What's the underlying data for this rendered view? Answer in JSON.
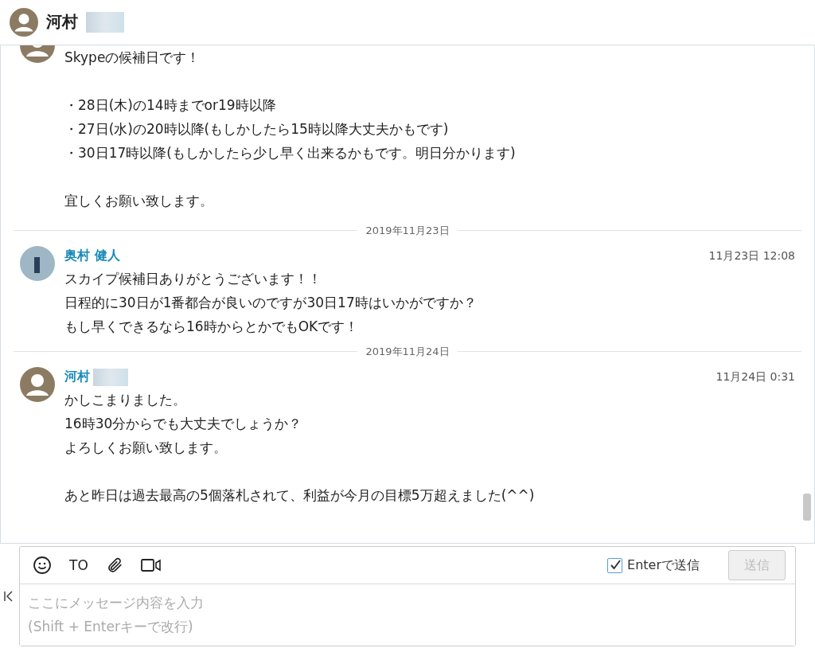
{
  "header": {
    "name": "河村"
  },
  "messages": [
    {
      "kind": "clipped",
      "paragraphs": [
        [
          "Skypeの候補日です！"
        ],
        [
          "・28日(木)の14時までor19時以降",
          "・27日(水)の20時以降(もしかしたら15時以降大丈夫かもです)",
          "・30日17時以降(もしかしたら少し早く出来るかもです。明日分かります)"
        ],
        [
          "宜しくお願い致します。"
        ]
      ]
    },
    {
      "kind": "date",
      "text": "2019年11月23日"
    },
    {
      "kind": "message",
      "has_photo": true,
      "name": "奥村 健人",
      "time": "11月23日 12:08",
      "paragraphs": [
        [
          "スカイプ候補日ありがとうございます！！",
          "日程的に30日が1番都合が良いのですが30日17時はいかがですか？",
          "もし早くできるなら16時からとかでもOKです！"
        ]
      ]
    },
    {
      "kind": "date",
      "text": "2019年11月24日"
    },
    {
      "kind": "message",
      "has_photo": false,
      "name": "河村",
      "time": "11月24日 0:31",
      "paragraphs": [
        [
          "かしこまりました。",
          "16時30分からでも大丈夫でしょうか？",
          "よろしくお願い致します。"
        ],
        [
          "あと昨日は過去最高の5個落札されて、利益が今月の目標5万超えました(^^)"
        ]
      ]
    }
  ],
  "composer": {
    "to_label": "TO",
    "enter_send": {
      "label": "Enterで送信",
      "checked": true
    },
    "send_button": {
      "label": "送信",
      "disabled": true
    },
    "placeholder": "ここにメッセージ内容を入力\n(Shift + Enterキーで改行)"
  }
}
